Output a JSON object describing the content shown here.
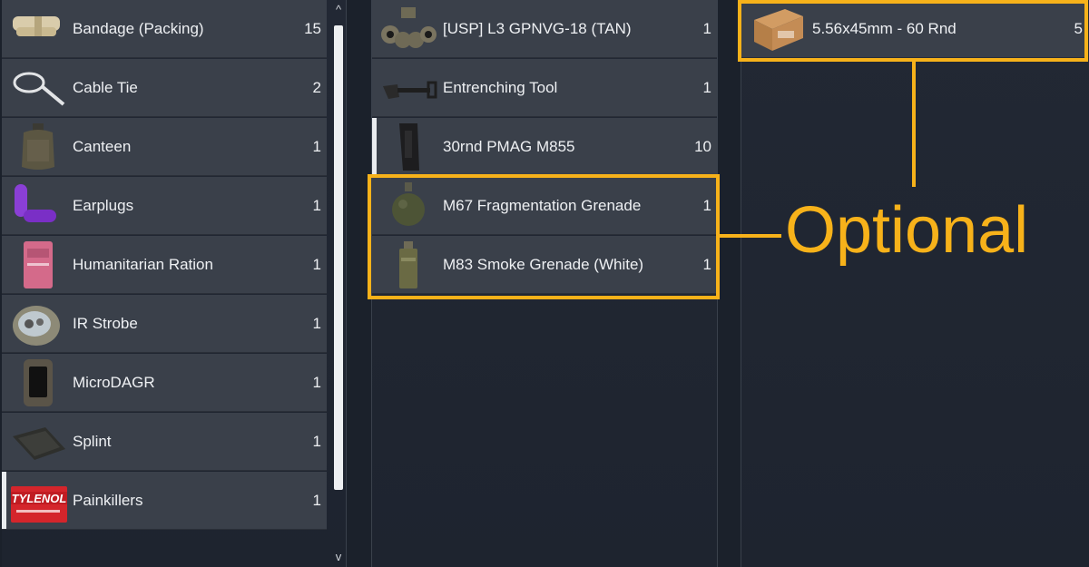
{
  "inventory_left": {
    "items": [
      {
        "label": "Bandage (Packing)",
        "count": "15",
        "icon": "bandage-icon"
      },
      {
        "label": "Cable Tie",
        "count": "2",
        "icon": "cable-tie-icon"
      },
      {
        "label": "Canteen",
        "count": "1",
        "icon": "canteen-icon"
      },
      {
        "label": "Earplugs",
        "count": "1",
        "icon": "earplugs-icon"
      },
      {
        "label": "Humanitarian Ration",
        "count": "1",
        "icon": "ration-icon"
      },
      {
        "label": "IR Strobe",
        "count": "1",
        "icon": "ir-strobe-icon"
      },
      {
        "label": "MicroDAGR",
        "count": "1",
        "icon": "microdagr-icon"
      },
      {
        "label": "Splint",
        "count": "1",
        "icon": "splint-icon"
      },
      {
        "label": "Painkillers",
        "count": "1",
        "icon": "painkillers-icon",
        "brand_text": "TYLENOL"
      }
    ],
    "scroll_up": "^",
    "scroll_down": "v"
  },
  "inventory_mid": {
    "items": [
      {
        "label": "[USP] L3 GPNVG-18 (TAN)",
        "count": "1",
        "icon": "nvg-icon"
      },
      {
        "label": "Entrenching Tool",
        "count": "1",
        "icon": "shovel-icon"
      },
      {
        "label": "30rnd PMAG M855",
        "count": "10",
        "icon": "magazine-icon"
      },
      {
        "label": "M67 Fragmentation Grenade",
        "count": "1",
        "icon": "frag-grenade-icon"
      },
      {
        "label": "M83 Smoke Grenade (White)",
        "count": "1",
        "icon": "smoke-grenade-icon"
      }
    ]
  },
  "inventory_right": {
    "items": [
      {
        "label": "5.56x45mm - 60 Rnd",
        "count": "5",
        "icon": "ammo-box-icon"
      }
    ]
  },
  "annotation": {
    "text": "Optional",
    "color": "#f7b21a"
  },
  "colors": {
    "row_bg": "#3a404a",
    "panel_bg": "#222834",
    "highlight": "#f7b21a"
  }
}
